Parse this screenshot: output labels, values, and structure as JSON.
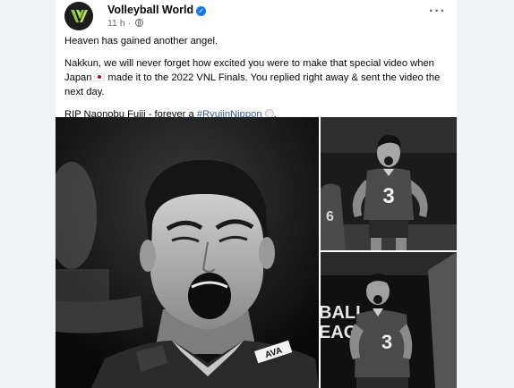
{
  "post": {
    "page_name": "Volleyball World",
    "timestamp": "11 h",
    "more_label": "···",
    "paragraphs": {
      "p1": "Heaven has gained another angel.",
      "p2_before_flag": "Nakkun, we will never forget how excited you were to make that special video when Japan",
      "p2_after_flag": "made it to the 2022 VNL Finals. You replied right away & sent the video the next day.",
      "p3_before": "RIP Naonobu Fujii - forever a",
      "p3_hashtag": "#RyujinNippon",
      "p3_after": "."
    }
  },
  "photos": {
    "main": {
      "logo_text": "AVA"
    },
    "top_right": {
      "jersey_number": "3",
      "bg_jersey_number": "6"
    },
    "bottom_right": {
      "banner_line1": "BALL",
      "banner_line2": "EAGUE",
      "jersey_number": "3"
    }
  },
  "colors": {
    "link": "#385898",
    "verified": "#1877f2",
    "meta": "#65676b",
    "brand": "#8ec63f"
  },
  "icons": {
    "verified": "verified-badge-icon",
    "globe": "globe-icon",
    "more": "more-options-icon",
    "flag": "japan-flag-emoji",
    "ball": "volleyball-emoji"
  }
}
